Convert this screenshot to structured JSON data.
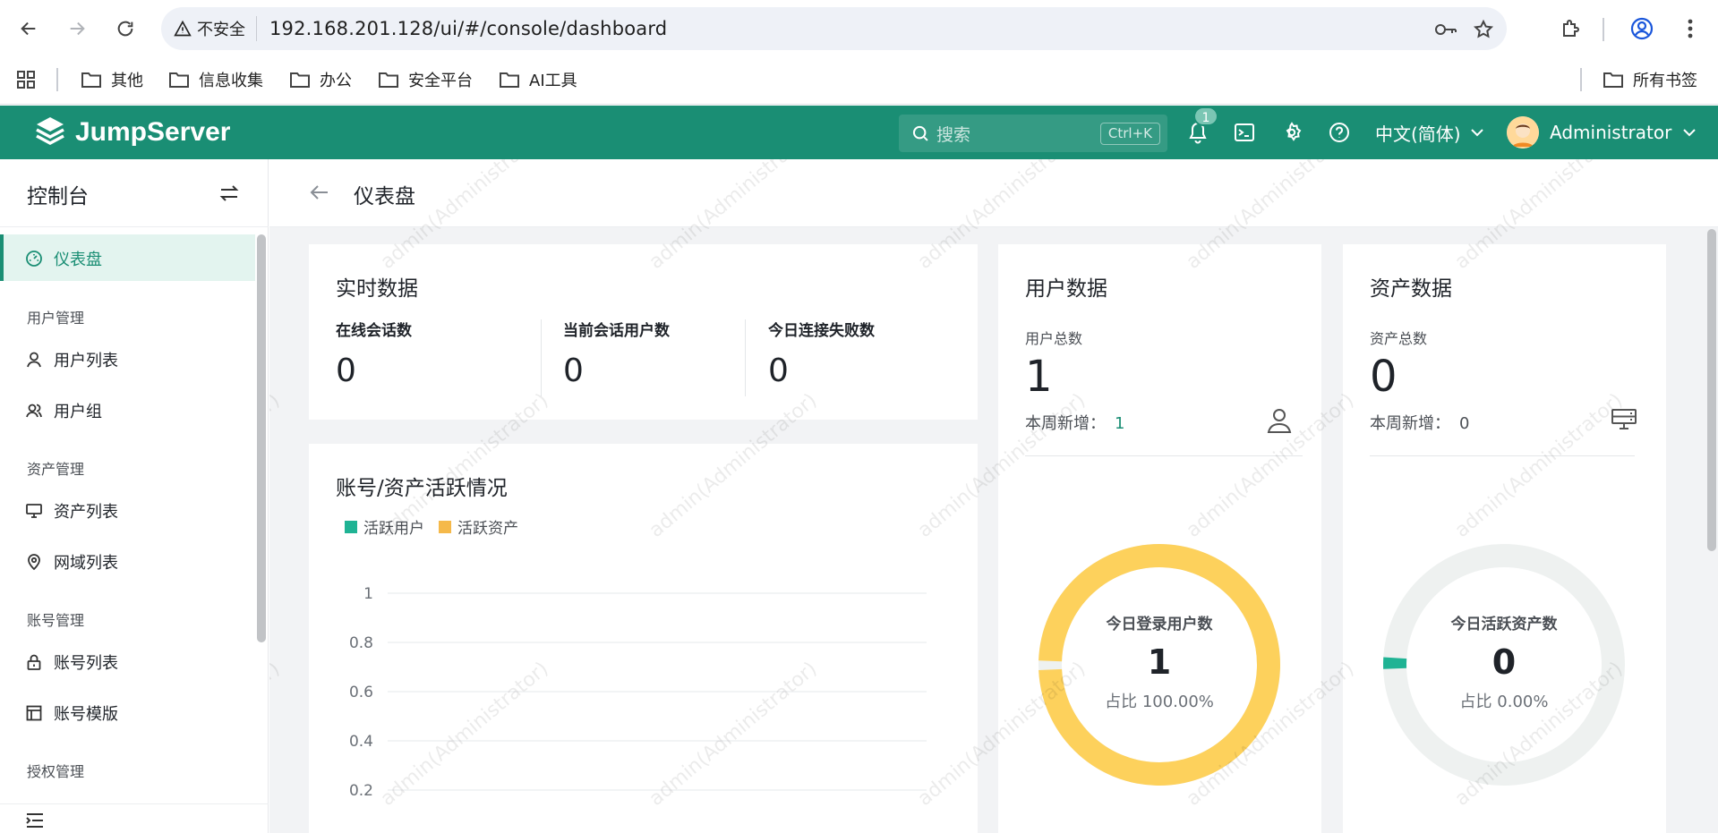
{
  "browser": {
    "security_label": "不安全",
    "url": "192.168.201.128/ui/#/console/dashboard",
    "bookmarks": [
      "其他",
      "信息收集",
      "办公",
      "安全平台",
      "AI工具"
    ],
    "all_bookmarks": "所有书签"
  },
  "header": {
    "brand": "JumpServer",
    "search_placeholder": "搜索",
    "search_shortcut": "Ctrl+K",
    "notification_count": "1",
    "language": "中文(简体)",
    "username": "Administrator",
    "accent_color": "#1a8e74"
  },
  "sidebar": {
    "title": "控制台",
    "items": [
      {
        "label": "仪表盘",
        "icon": "dashboard-icon"
      },
      {
        "group": "用户管理"
      },
      {
        "label": "用户列表",
        "icon": "user-icon"
      },
      {
        "label": "用户组",
        "icon": "user-group-icon"
      },
      {
        "group": "资产管理"
      },
      {
        "label": "资产列表",
        "icon": "monitor-icon"
      },
      {
        "label": "网域列表",
        "icon": "location-pin-icon"
      },
      {
        "group": "账号管理"
      },
      {
        "label": "账号列表",
        "icon": "lock-icon"
      },
      {
        "label": "账号模版",
        "icon": "template-icon"
      },
      {
        "group": "授权管理"
      }
    ]
  },
  "page": {
    "title": "仪表盘",
    "realtime": {
      "title": "实时数据",
      "stats": [
        {
          "label": "在线会话数",
          "value": "0"
        },
        {
          "label": "当前会话用户数",
          "value": "0"
        },
        {
          "label": "今日连接失败数",
          "value": "0"
        }
      ]
    },
    "activity": {
      "title": "账号/资产活跃情况",
      "legend": [
        {
          "name": "活跃用户",
          "color": "#1fb394"
        },
        {
          "name": "活跃资产",
          "color": "#f5b94a"
        }
      ],
      "y_ticks": [
        "1",
        "0.8",
        "0.6",
        "0.4",
        "0.2"
      ]
    },
    "users": {
      "title": "用户数据",
      "total_label": "用户总数",
      "total": "1",
      "week_label": "本周新增：",
      "week_value": "1",
      "donut_title": "今日登录用户数",
      "donut_value": "1",
      "donut_ratio": "占比 100.00%",
      "donut_fraction": 1.0,
      "donut_color": "#fdd15c"
    },
    "assets": {
      "title": "资产数据",
      "total_label": "资产总数",
      "total": "0",
      "week_label": "本周新增：",
      "week_value": "0",
      "donut_title": "今日活跃资产数",
      "donut_value": "0",
      "donut_ratio": "占比 0.00%",
      "donut_fraction": 0.0,
      "donut_color": "#1fb394"
    }
  },
  "chart_data": {
    "type": "line",
    "title": "账号/资产活跃情况",
    "series": [
      {
        "name": "活跃用户",
        "values": []
      },
      {
        "name": "活跃资产",
        "values": []
      }
    ],
    "y_ticks": [
      1,
      0.8,
      0.6,
      0.4,
      0.2
    ],
    "grid": true,
    "legend": "top-left"
  },
  "watermark_text": "admin(Administrator)"
}
